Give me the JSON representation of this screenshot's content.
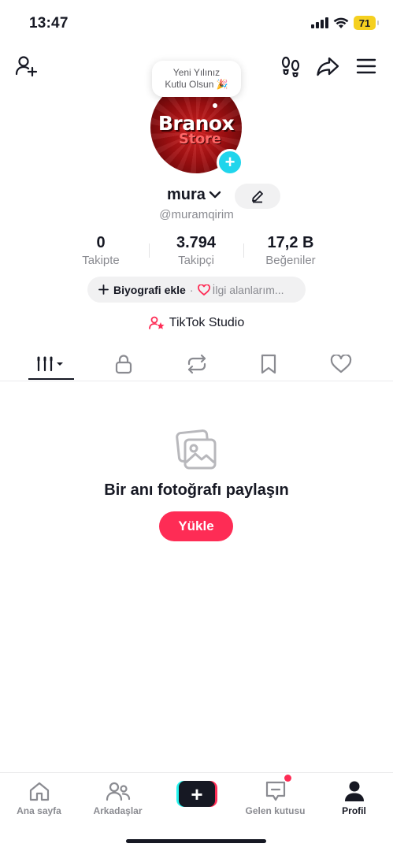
{
  "status": {
    "time": "13:47",
    "battery": "71"
  },
  "profile": {
    "bubble_line1": "Yeni Yılınız",
    "bubble_line2": "Kutlu Olsun",
    "bubble_emoji": "🎉",
    "avatar_logo_top": "Branox",
    "avatar_logo_bottom": "Store",
    "name": "mura",
    "handle": "@muramqirim"
  },
  "stats": [
    {
      "value": "0",
      "label": "Takipte"
    },
    {
      "value": "3.794",
      "label": "Takipçi"
    },
    {
      "value": "17,2 B",
      "label": "Beğeniler"
    }
  ],
  "bio": {
    "add_label": "Biyografi ekle",
    "separator": "·",
    "interests_label": "İlgi alanlarım..."
  },
  "studio": {
    "label": "TikTok Studio"
  },
  "tabs": [
    "videos-tab",
    "private-tab",
    "reposts-tab",
    "favorites-tab",
    "liked-tab"
  ],
  "empty_state": {
    "title": "Bir anı fotoğrafı paylaşın",
    "button": "Yükle"
  },
  "bottom_nav": {
    "home": "Ana sayfa",
    "friends": "Arkadaşlar",
    "create": "+",
    "inbox": "Gelen kutusu",
    "profile": "Profil"
  },
  "colors": {
    "accent": "#fe2c55",
    "cyan": "#20d5ec",
    "text": "#161823",
    "muted": "#8a8b91",
    "battery": "#f5d020"
  }
}
